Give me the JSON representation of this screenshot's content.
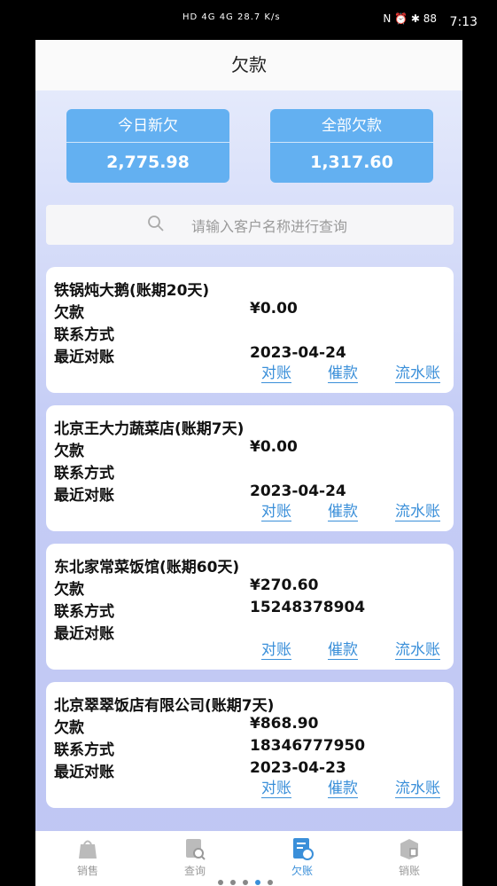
{
  "status": {
    "left_text": "HD 4G 4G 28.7 K/s",
    "right_text": "N ⏰ ✱ 88",
    "time": "7:13"
  },
  "header": {
    "title": "欠款"
  },
  "summary": {
    "today_label": "今日新欠",
    "today_value": "2,775.98",
    "total_label": "全部欠款",
    "total_value": "1,317.60"
  },
  "search": {
    "placeholder": "请输入客户名称进行查询"
  },
  "labels": {
    "debt": "欠款",
    "contact": "联系方式",
    "last_reconcile": "最近对账",
    "reconcile": "对账",
    "remind": "催款",
    "ledger": "流水账"
  },
  "customers": [
    {
      "name": "铁锅炖大鹅(账期20天)",
      "debt": "¥0.00",
      "contact": "",
      "last_date": "2023-04-24"
    },
    {
      "name": "北京王大力蔬菜店(账期7天)",
      "debt": "¥0.00",
      "contact": "",
      "last_date": "2023-04-24"
    },
    {
      "name": "东北家常菜饭馆(账期60天)",
      "debt": "¥270.60",
      "contact": "15248378904",
      "last_date": ""
    },
    {
      "name": "北京翠翠饭店有限公司(账期7天)",
      "debt": "¥868.90",
      "contact": "18346777950",
      "last_date": "2023-04-23"
    }
  ],
  "tabs": [
    {
      "label": "销售"
    },
    {
      "label": "查询"
    },
    {
      "label": "欠账"
    },
    {
      "label": "销账"
    }
  ],
  "colors": {
    "accent": "#3a8fd9",
    "summary_box": "#63b0f1"
  }
}
